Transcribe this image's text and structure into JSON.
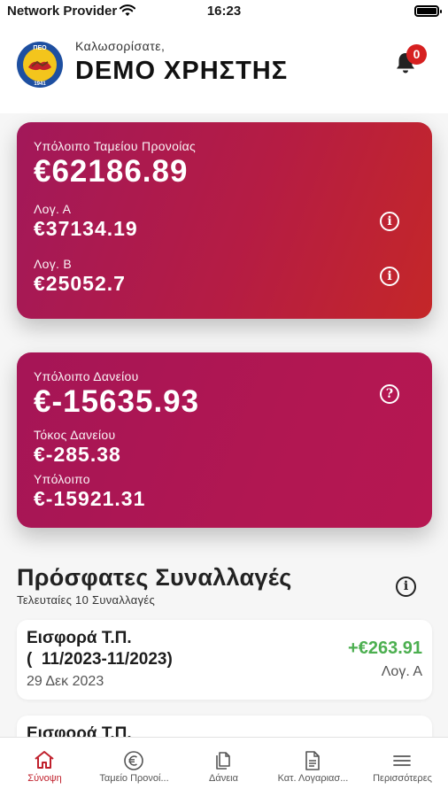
{
  "status_bar": {
    "carrier": "Network Provider",
    "time": "16:23"
  },
  "header": {
    "welcome": "Καλωσορίσατε,",
    "username": "DEMO ΧΡΗΣΤΗΣ",
    "notification_count": "0",
    "logo_text_top": "ΠΕΟ",
    "logo_text_bottom": "1941"
  },
  "provident_card": {
    "label": "Υπόλοιπο Ταμείου Προνοίας",
    "balance": "€62186.89",
    "account_a_label": "Λογ. Α",
    "account_a_value": "€37134.19",
    "account_b_label": "Λογ. Β",
    "account_b_value": "€25052.7"
  },
  "loan_card": {
    "label": "Υπόλοιπο Δανείου",
    "balance": "€-15635.93",
    "interest_label": "Τόκος Δανείου",
    "interest_value": "€-285.38",
    "remaining_label": "Υπόλοιπο",
    "remaining_value": "€-15921.31"
  },
  "recent": {
    "title": "Πρόσφατες Συναλλαγές",
    "subtitle": "Τελευταίες 10 Συναλλαγές",
    "transactions": [
      {
        "title": "Εισφορά Τ.Π.\n(  11/2023-11/2023)",
        "date": "29 Δεκ 2023",
        "amount": "+€263.91",
        "account": "Λογ. Α"
      },
      {
        "title": "Εισφορά Τ.Π."
      }
    ]
  },
  "tabs": [
    {
      "label": "Σύνοψη",
      "icon": "home-icon",
      "active": true
    },
    {
      "label": "Ταμείο Προνοί...",
      "icon": "euro-icon",
      "active": false
    },
    {
      "label": "Δάνεια",
      "icon": "documents-icon",
      "active": false
    },
    {
      "label": "Κατ. Λογαριασ...",
      "icon": "statement-icon",
      "active": false
    },
    {
      "label": "Περισσότερες",
      "icon": "menu-icon",
      "active": false
    }
  ],
  "colors": {
    "accent_red": "#c0202c",
    "card_magenta": "#a2185a",
    "positive_green": "#4caf50"
  }
}
